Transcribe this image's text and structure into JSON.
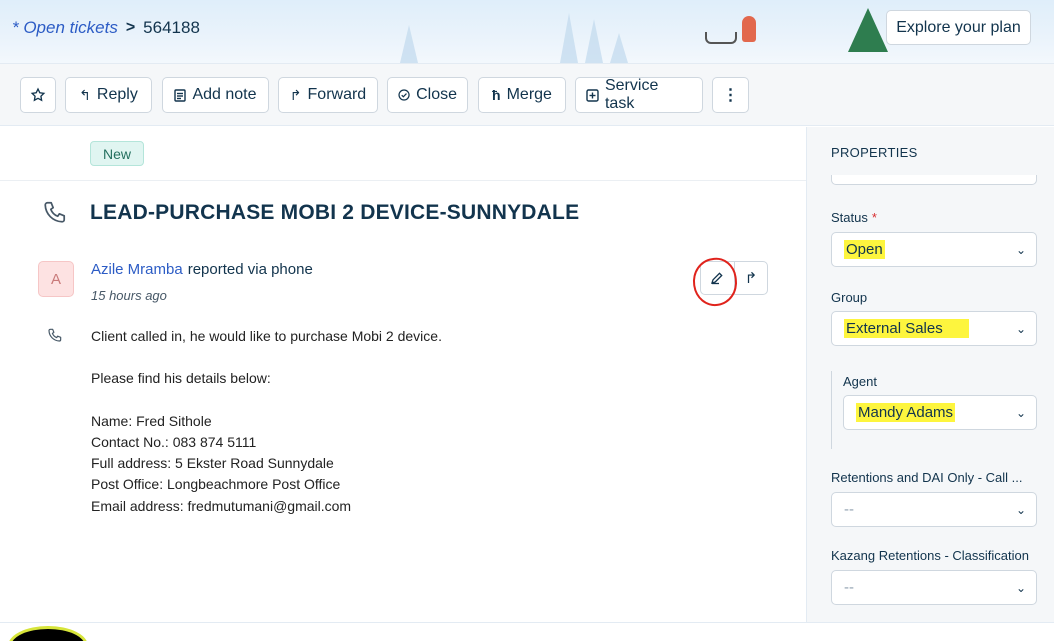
{
  "header": {
    "breadcrumb_link": "* Open tickets",
    "breadcrumb_separator": ">",
    "ticket_id": "564188",
    "explore_label": "Explore your plan"
  },
  "toolbar": {
    "reply": "Reply",
    "add_note": "Add note",
    "forward": "Forward",
    "close": "Close",
    "merge": "Merge",
    "service_task": "Service task",
    "more": "⋮"
  },
  "ticket": {
    "status_badge": "New",
    "subject": "LEAD-PURCHASE MOBI 2 DEVICE-SUNNYDALE",
    "avatar_letter": "A",
    "reporter_name": "Azile Mramba",
    "reporter_via": "reported via phone",
    "time_ago": "15 hours ago",
    "description_lines": [
      "Client called in, he would like to purchase Mobi 2 device.",
      "",
      "Please find his details below:",
      "",
      "Name: Fred Sithole",
      "Contact No.: 083 874 5111",
      "Full address: 5 Ekster Road Sunnydale",
      "Post Office: Longbeachmore Post Office",
      "Email address: fredmutumani@gmail.com"
    ]
  },
  "properties": {
    "title": "PROPERTIES",
    "status_label": "Status",
    "status_required": "*",
    "status_value": "Open",
    "group_label": "Group",
    "group_value": "External Sales",
    "agent_label": "Agent",
    "agent_value": "Mandy Adams",
    "retentions_label": "Retentions and DAI Only - Call ...",
    "retentions_value": "--",
    "kazang_label": "Kazang Retentions - Classification",
    "kazang_value": "--"
  },
  "colors": {
    "link": "#2c5cc5",
    "highlight": "#fdf53e",
    "annotation": "#e0231c",
    "badge_bg": "#e0f5f1"
  }
}
